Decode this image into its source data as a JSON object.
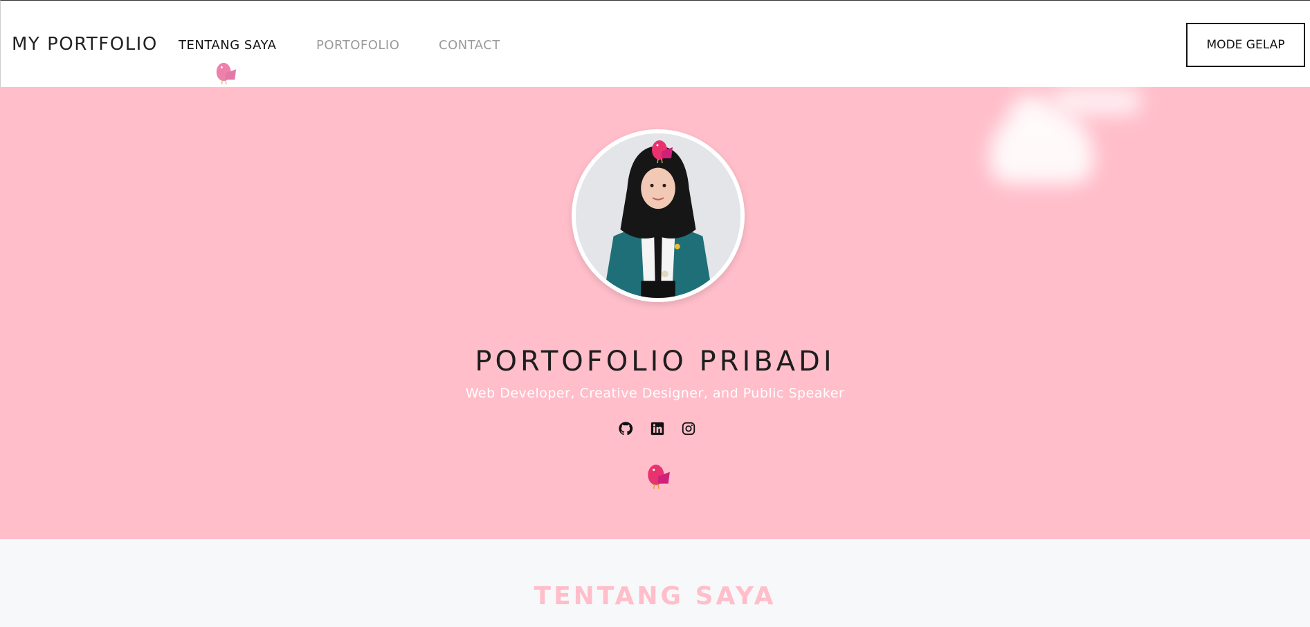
{
  "navbar": {
    "brand": "MY PORTFOLIO",
    "links": [
      {
        "label": "TENTANG SAYA",
        "active": true
      },
      {
        "label": "PORTOFOLIO",
        "active": false
      },
      {
        "label": "CONTACT",
        "active": false
      }
    ],
    "mode_button": "MODE GELAP"
  },
  "hero": {
    "title": "PORTOFOLIO PRIBADI",
    "subtitle": "Web Developer, Creative Designer, and Public Speaker",
    "social_icons": [
      "github-icon",
      "linkedin-icon",
      "instagram-icon"
    ],
    "background_color": "#ffbeca"
  },
  "about": {
    "title": "TENTANG SAYA",
    "title_color": "#ffbeca"
  }
}
